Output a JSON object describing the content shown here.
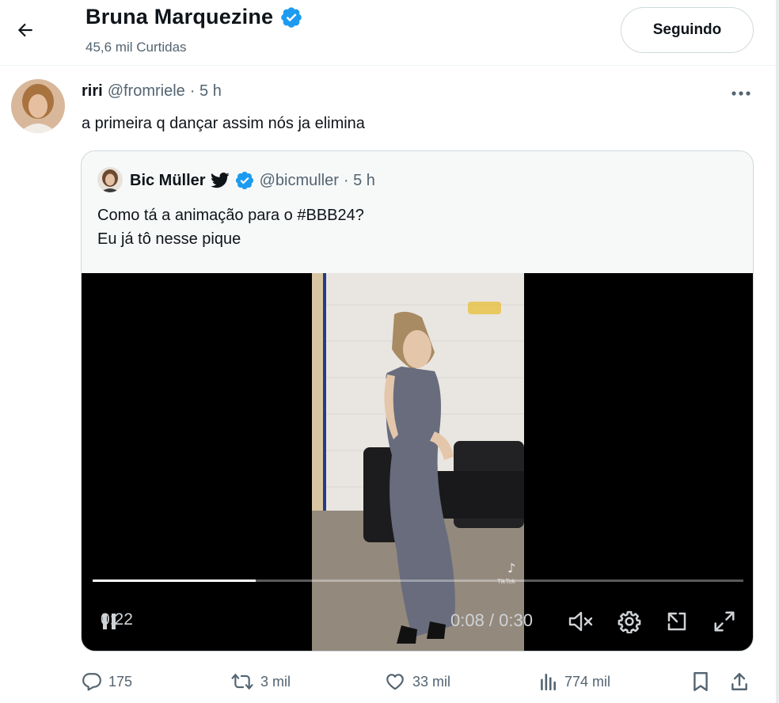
{
  "header": {
    "title": "Bruna Marquezine",
    "subtitle": "45,6 mil Curtidas",
    "follow_label": "Seguindo"
  },
  "tweet": {
    "name": "riri",
    "handle": "@fromriele",
    "time": "· 5 h",
    "text": "a primeira q dançar assim nós ja elimina"
  },
  "quote": {
    "name": "Bic Müller",
    "handle": "@bicmuller",
    "time": "· 5 h",
    "lines": [
      "Como tá a animação para o #BBB24?",
      "Eu já tô nesse pique"
    ],
    "video": {
      "time_remaining": "0:22",
      "time_current": "0:08 / 0:30",
      "progress": 0.25,
      "watermark": "TikTok"
    }
  },
  "actions": {
    "replies": "175",
    "retweets": "3 mil",
    "likes": "33 mil",
    "views": "774 mil"
  },
  "icons": {
    "back": "back-arrow-icon",
    "verified": "verified-badge-icon",
    "more": "more-icon",
    "bird": "twitter-bird-icon"
  },
  "colors": {
    "verified": "#1d9bf0",
    "muted_text": "#536471",
    "border": "#cfd9de"
  }
}
